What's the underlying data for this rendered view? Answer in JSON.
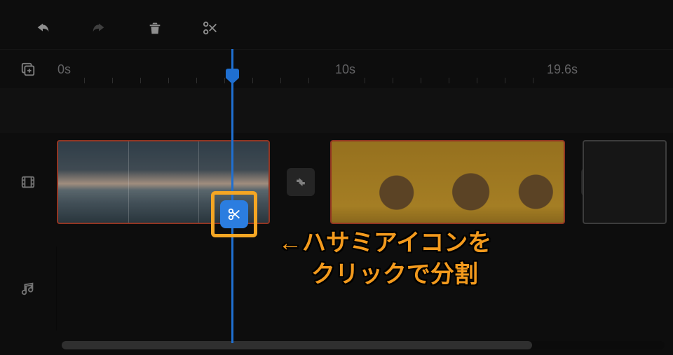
{
  "toolbar": {
    "undo": "undo",
    "redo": "redo",
    "delete": "delete",
    "split": "split"
  },
  "ruler": {
    "t0": "0s",
    "t1": "10s",
    "t2": "19.6s"
  },
  "side": {
    "add": "add-media",
    "video": "video-track",
    "audio": "audio-track"
  },
  "split_button_label": "split",
  "annotation": {
    "line1": "←ハサミアイコンを",
    "line2": "クリックで分割"
  }
}
